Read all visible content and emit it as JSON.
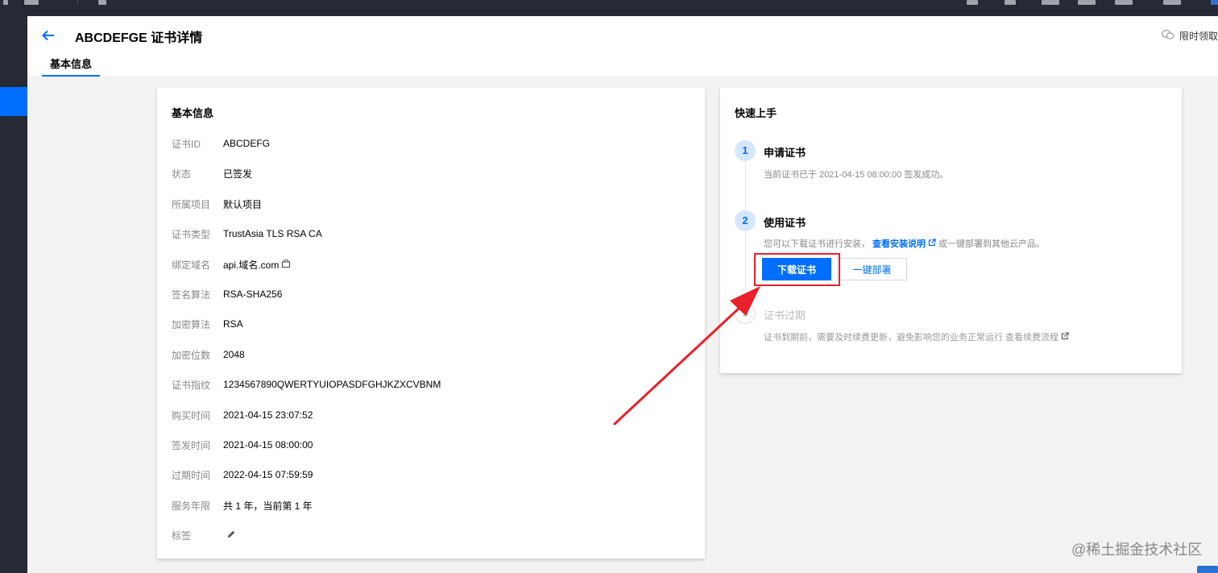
{
  "header": {
    "title": "ABCDEFGE 证书详情",
    "promo_text": "限时领取",
    "tab_label": "基本信息"
  },
  "basic_info": {
    "title": "基本信息",
    "rows": [
      {
        "label": "证书ID",
        "value": "ABCDEFG"
      },
      {
        "label": "状态",
        "value": "已签发"
      },
      {
        "label": "所属项目",
        "value": "默认项目"
      },
      {
        "label": "证书类型",
        "value": "TrustAsia TLS RSA CA"
      },
      {
        "label": "绑定域名",
        "value": "api.域名.com"
      },
      {
        "label": "签名算法",
        "value": "RSA-SHA256"
      },
      {
        "label": "加密算法",
        "value": "RSA"
      },
      {
        "label": "加密位数",
        "value": "2048"
      },
      {
        "label": "证书指纹",
        "value": "1234567890QWERTYUIOPASDFGHJKZXCVBNM"
      },
      {
        "label": "购买时间",
        "value": "2021-04-15 23:07:52"
      },
      {
        "label": "签发时间",
        "value": "2021-04-15 08:00:00"
      },
      {
        "label": "过期时间",
        "value": "2022-04-15 07:59:59"
      },
      {
        "label": "服务年限",
        "value": "共 1 年，当前第 1 年"
      },
      {
        "label": "标签",
        "value": ""
      }
    ]
  },
  "quick_start": {
    "title": "快速上手",
    "steps": [
      {
        "num": "1",
        "title": "申请证书",
        "desc": "当前证书已于 2021-04-15 08:00:00 签发成功。"
      },
      {
        "num": "2",
        "title": "使用证书",
        "desc_prefix": "您可以下载证书进行安装，",
        "link": "查看安装说明",
        "desc_suffix": "或一键部署到其他云产品。"
      },
      {
        "num": "3",
        "title": "证书过期",
        "desc": "证书到期前，需要及时续费更新，避免影响您的业务正常运行 查看续费流程"
      }
    ],
    "download_button": "下载证书",
    "deploy_button": "一键部署"
  },
  "watermark": "@稀土掘金技术社区",
  "colors": {
    "accent": "#006eff",
    "annotation": "#e8212a",
    "nav_dark": "#252a36"
  }
}
